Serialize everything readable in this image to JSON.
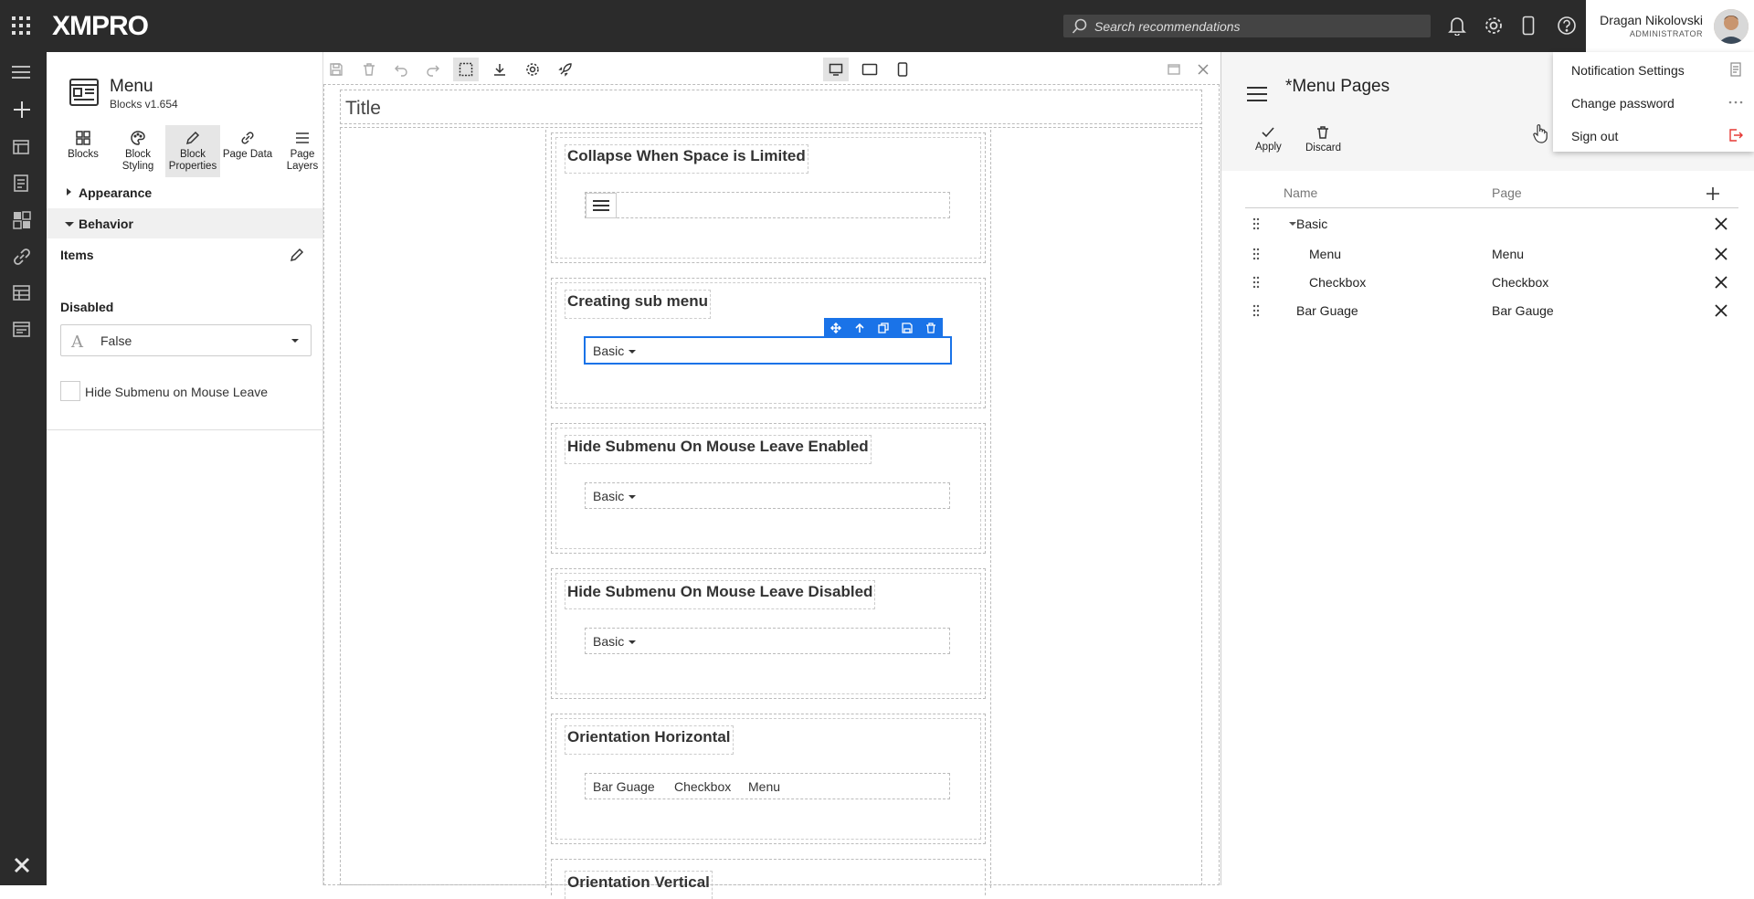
{
  "app": {
    "logo_text": "XMPRO"
  },
  "header": {
    "search_placeholder": "Search recommendations",
    "user": {
      "name": "Dragan Nikolovski",
      "role": "ADMINISTRATOR"
    }
  },
  "user_menu": {
    "items": [
      {
        "label": "Notification Settings",
        "icon": "notification-settings-icon"
      },
      {
        "label": "Change password",
        "icon": "ellipsis-icon"
      },
      {
        "label": "Sign out",
        "icon": "sign-out-icon",
        "color": "#e53935"
      }
    ]
  },
  "props_panel": {
    "block_name": "Menu",
    "block_version": "Blocks v1.654",
    "tabs": [
      {
        "label": "Blocks",
        "icon": "blocks-icon"
      },
      {
        "label": "Block Styling",
        "icon": "palette-icon"
      },
      {
        "label": "Block Properties",
        "icon": "pencil-icon",
        "active": true
      },
      {
        "label": "Page Data",
        "icon": "link-icon"
      },
      {
        "label": "Page Layers",
        "icon": "layers-icon"
      }
    ],
    "sections": {
      "appearance": "Appearance",
      "behavior": "Behavior"
    },
    "items_label": "Items",
    "disabled_label": "Disabled",
    "disabled_value": "False",
    "hide_submenu_label": "Hide Submenu on Mouse Leave",
    "hide_submenu_checked": false
  },
  "canvas": {
    "title": "Title",
    "cards": [
      {
        "title": "Collapse When Space is Limited",
        "menu_type": "hamburger"
      },
      {
        "title": "Creating sub menu",
        "items": [
          "Basic"
        ],
        "selected": true
      },
      {
        "title": "Hide Submenu On Mouse Leave Enabled",
        "items": [
          "Basic"
        ]
      },
      {
        "title": "Hide Submenu On Mouse Leave Disabled",
        "items": [
          "Basic"
        ]
      },
      {
        "title": "Orientation Horizontal",
        "items": [
          "Bar Guage",
          "Checkbox",
          "Menu"
        ]
      },
      {
        "title": "Orientation Vertical"
      }
    ]
  },
  "right_panel": {
    "title": "*Menu Pages",
    "apply_label": "Apply",
    "discard_label": "Discard",
    "columns": {
      "name": "Name",
      "page": "Page"
    },
    "rows": [
      {
        "name": "Basic",
        "page": "",
        "level": 0,
        "expanded": true
      },
      {
        "name": "Menu",
        "page": "Menu",
        "level": 1
      },
      {
        "name": "Checkbox",
        "page": "Checkbox",
        "level": 1
      },
      {
        "name": "Bar Guage",
        "page": "Bar Gauge",
        "level": 0
      }
    ]
  },
  "colors": {
    "accent": "#1a73e8",
    "topbar": "#2b2b2b",
    "sign_out": "#e53935"
  }
}
